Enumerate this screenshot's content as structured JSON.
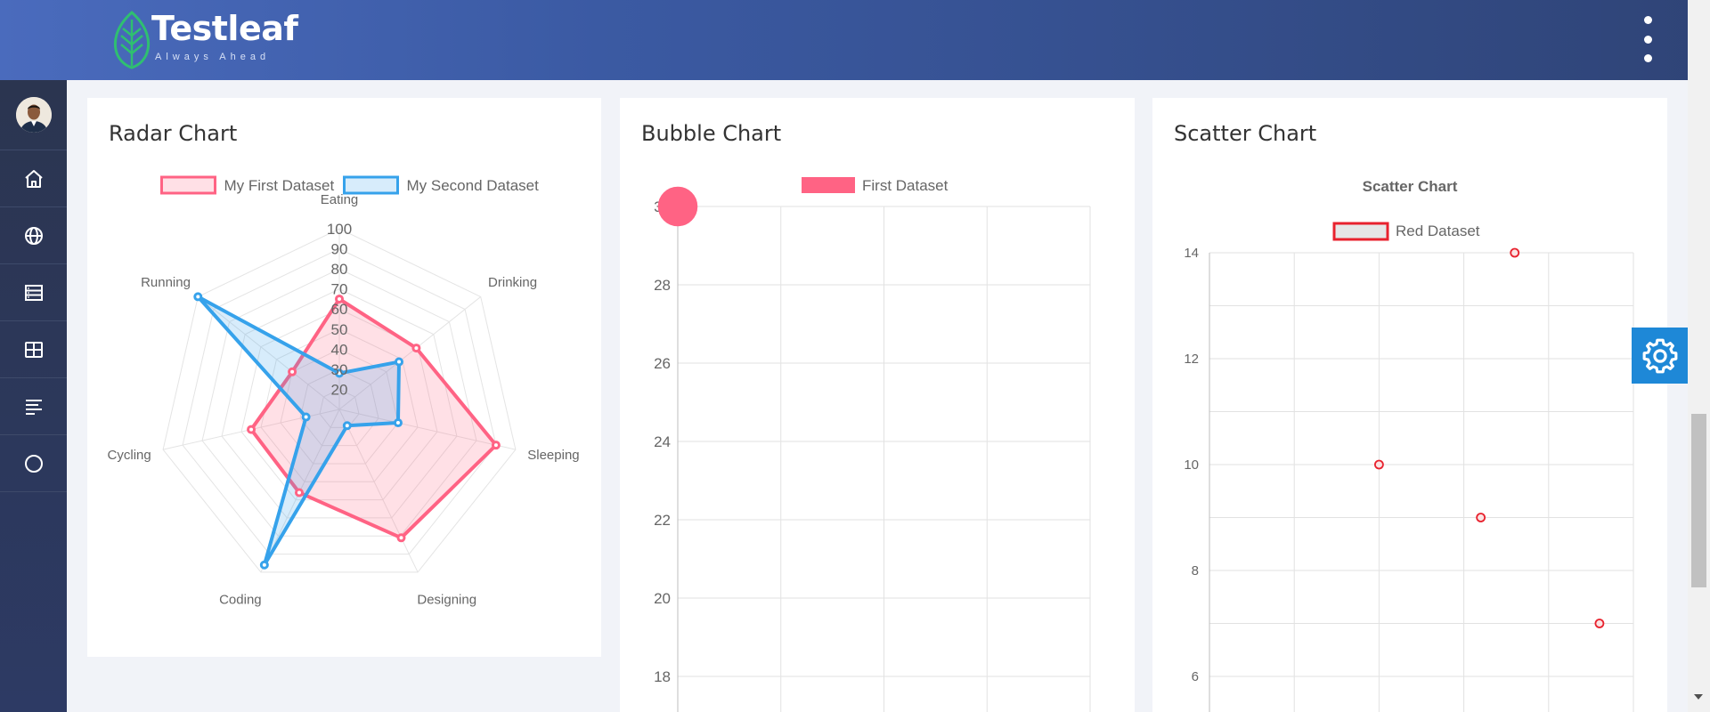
{
  "header": {
    "brand": "Testleaf",
    "tagline": "Always Ahead"
  },
  "sidebar": {
    "items": [
      {
        "name": "home",
        "icon": "home-icon"
      },
      {
        "name": "globe",
        "icon": "globe-icon"
      },
      {
        "name": "table",
        "icon": "table-icon"
      },
      {
        "name": "grid",
        "icon": "grid-icon"
      },
      {
        "name": "menu",
        "icon": "align-left-icon"
      },
      {
        "name": "circle",
        "icon": "circle-icon"
      }
    ]
  },
  "cards": {
    "radar": {
      "title": "Radar Chart"
    },
    "bubble": {
      "title": "Bubble Chart"
    },
    "scatter": {
      "title": "Scatter Chart"
    }
  },
  "colors": {
    "red": "#ff6384",
    "blue": "#36a2eb",
    "scatter_red": "#e8222e",
    "header_start": "#4a6bbd",
    "header_end": "#2f4477",
    "accent": "#1e88d7"
  },
  "chart_data": [
    {
      "type": "radar",
      "labels": [
        "Eating",
        "Drinking",
        "Sleeping",
        "Designing",
        "Coding",
        "Cycling",
        "Running"
      ],
      "r_ticks": [
        "20",
        "30",
        "40",
        "50",
        "60",
        "70",
        "80",
        "90",
        "100"
      ],
      "r_min": 10,
      "r_max": 100,
      "legend": "top",
      "series": [
        {
          "name": "My First Dataset",
          "values": [
            65,
            59,
            90,
            81,
            56,
            55,
            40
          ],
          "color": "#ff6384"
        },
        {
          "name": "My Second Dataset",
          "values": [
            28,
            48,
            40,
            19,
            96,
            27,
            100
          ],
          "color": "#36a2eb"
        }
      ]
    },
    {
      "type": "bubble",
      "legend": "top",
      "y_ticks": [
        "30",
        "28",
        "26",
        "24",
        "22",
        "20",
        "18"
      ],
      "ylim": [
        18,
        30
      ],
      "xlim": [
        0,
        4
      ],
      "series": [
        {
          "name": "First Dataset",
          "color": "#ff6384",
          "points": [
            {
              "x": 0,
              "y": 30,
              "r": 15
            }
          ]
        }
      ]
    },
    {
      "type": "scatter",
      "title": "Scatter Chart",
      "legend": "top",
      "y_ticks": [
        "14",
        "12",
        "10",
        "8",
        "6"
      ],
      "ylim": [
        6,
        14
      ],
      "xlim": [
        0,
        5
      ],
      "series": [
        {
          "name": "Red Dataset",
          "color": "#e8222e",
          "points": [
            {
              "x": 3.6,
              "y": 14
            },
            {
              "x": 2,
              "y": 10
            },
            {
              "x": 3.2,
              "y": 9
            },
            {
              "x": 4.6,
              "y": 7
            }
          ]
        }
      ]
    }
  ]
}
